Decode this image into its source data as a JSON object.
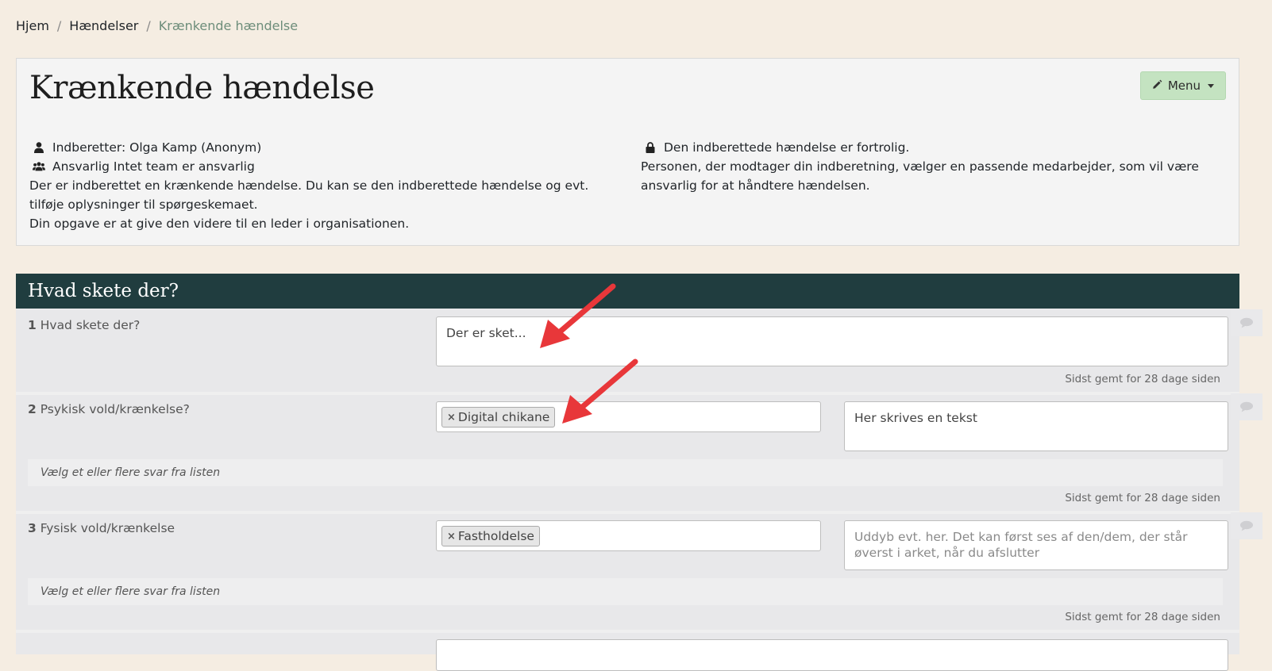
{
  "breadcrumb": {
    "home": "Hjem",
    "events": "Hændelser",
    "current": "Krænkende hændelse",
    "separator": "/"
  },
  "header": {
    "title": "Krænkende hændelse",
    "menu_label": "Menu",
    "reporter": "Indberetter: Olga Kamp (Anonym)",
    "responsible": "Ansvarlig Intet team er ansvarlig",
    "description_1": "Der er indberettet en krænkende hændelse. Du kan se den indberettede hændelse og evt. tilføje oplysninger til spørgeskemaet.",
    "description_2": "Din opgave er at give den videre til en leder i organisationen.",
    "confidential": "Den indberettede hændelse er fortrolig.",
    "confidential_info": "Personen, der modtager din indberetning, vælger en passende medarbejder, som vil være ansvarlig for at håndtere hændelsen."
  },
  "section": {
    "title": "Hvad skete der?",
    "questions": [
      {
        "num": "1",
        "label": "Hvad skete der?",
        "value": "Der er sket...",
        "saved": "Sidst gemt for 28 dage siden"
      },
      {
        "num": "2",
        "label": "Psykisk vold/krænkelse?",
        "tag": "Digital chikane",
        "text_value": "Her skrives en tekst",
        "hint": "Vælg et eller flere svar fra listen",
        "saved": "Sidst gemt for 28 dage siden"
      },
      {
        "num": "3",
        "label": "Fysisk vold/krænkelse",
        "tag": "Fastholdelse",
        "placeholder": "Uddyb evt. her. Det kan først ses af den/dem, der står øverst i arket, når du afslutter",
        "hint": "Vælg et eller flere svar fra listen",
        "saved": "Sidst gemt for 28 dage siden"
      }
    ]
  },
  "icons": {
    "user": "user-icon",
    "users": "users-icon",
    "lock": "lock-icon",
    "pencil": "pencil-icon",
    "comment": "comment-icon",
    "remove": "remove-tag-icon"
  },
  "colors": {
    "background": "#f5ede2",
    "section_header": "#203d3f",
    "menu_button": "#c4e3c1",
    "breadcrumb_active": "#6d8d7a",
    "annotation_arrow": "#e8373a"
  }
}
